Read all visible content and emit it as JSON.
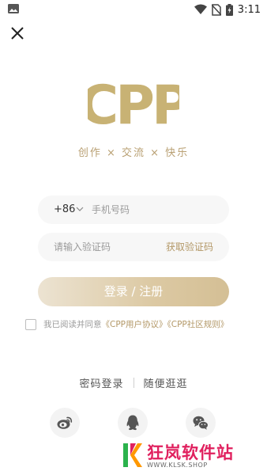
{
  "status_bar": {
    "time": "3:11"
  },
  "brand": {
    "logo_text": "CPP",
    "tagline": "创作 × 交流 × 快乐"
  },
  "phone": {
    "country_code": "+86",
    "placeholder": "手机号码"
  },
  "code": {
    "placeholder": "请输入验证码",
    "get_code": "获取验证码"
  },
  "login_button": "登录 / 注册",
  "agreement": {
    "prefix": "我已阅读并同意",
    "user_agreement": "《CPP用户协议》",
    "community_rules": "《CPP社区规则》"
  },
  "alt_options": {
    "password_login": "密码登录",
    "browse": "随便逛逛"
  },
  "social": [
    "weibo-icon",
    "qq-icon",
    "wechat-icon"
  ],
  "watermark": {
    "title": "狂岚软件站",
    "url": "WWW.KLSK.SHOP"
  },
  "colors": {
    "gold": "#c8b274",
    "accent": "#b39867",
    "button_start": "#ece3d2",
    "button_end": "#d4bf95",
    "watermark": "#e0205e"
  }
}
